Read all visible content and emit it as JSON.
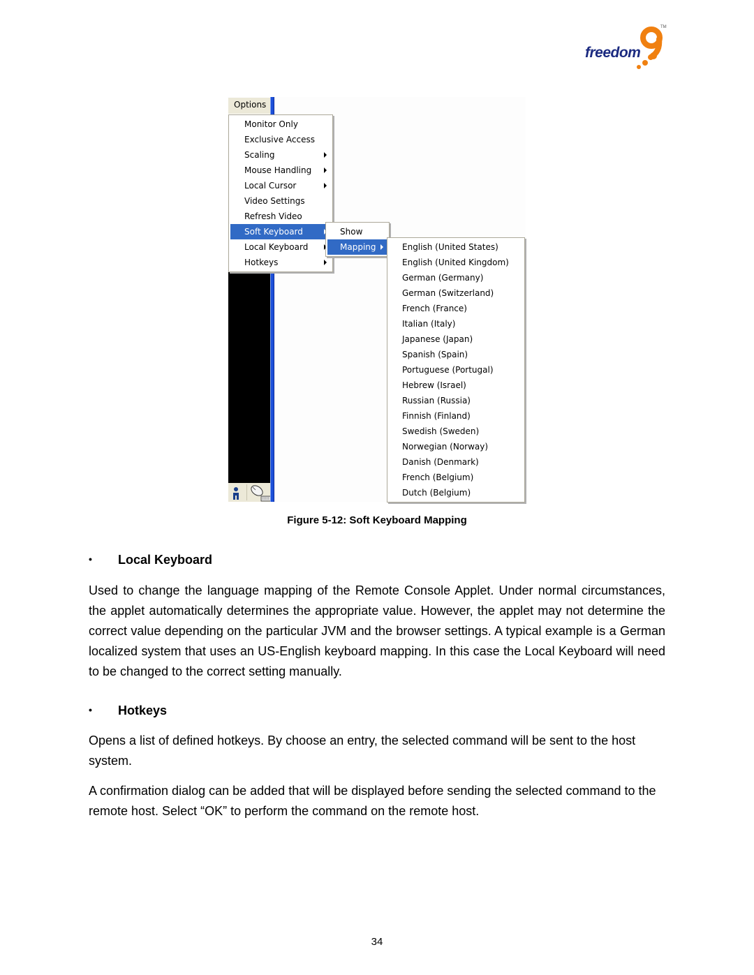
{
  "logo": {
    "text": "freedom",
    "numeral": "9",
    "trademark": "TM",
    "colors": {
      "text": "#1b2a80",
      "accent": "#f08010"
    }
  },
  "figure": {
    "menubar_label": "Options",
    "options_menu": [
      {
        "label": "Monitor Only",
        "submenu": false,
        "selected": false
      },
      {
        "label": "Exclusive Access",
        "submenu": false,
        "selected": false
      },
      {
        "label": "Scaling",
        "submenu": true,
        "selected": false
      },
      {
        "label": "Mouse Handling",
        "submenu": true,
        "selected": false
      },
      {
        "label": "Local Cursor",
        "submenu": true,
        "selected": false
      },
      {
        "label": "Video Settings",
        "submenu": false,
        "selected": false
      },
      {
        "label": "Refresh Video",
        "submenu": false,
        "selected": false
      },
      {
        "label": "Soft Keyboard",
        "submenu": true,
        "selected": true
      },
      {
        "label": "Local Keyboard",
        "submenu": true,
        "selected": false
      },
      {
        "label": "Hotkeys",
        "submenu": true,
        "selected": false
      }
    ],
    "soft_keyboard_menu": [
      {
        "label": "Show",
        "submenu": false,
        "selected": false
      },
      {
        "label": "Mapping",
        "submenu": true,
        "selected": true
      }
    ],
    "mapping_menu": [
      "English (United States)",
      "English (United Kingdom)",
      "German (Germany)",
      "German (Switzerland)",
      "French (France)",
      "Italian (Italy)",
      "Japanese (Japan)",
      "Spanish (Spain)",
      "Portuguese (Portugal)",
      "Hebrew (Israel)",
      "Russian (Russia)",
      "Finnish (Finland)",
      "Swedish (Sweden)",
      "Norwegian (Norway)",
      "Danish (Denmark)",
      "French (Belgium)",
      "Dutch (Belgium)"
    ],
    "selection_color": "#316ac5",
    "caption": "Figure 5-12: Soft Keyboard Mapping"
  },
  "sections": [
    {
      "bullet": "•",
      "heading": "Local Keyboard",
      "paragraphs": [
        "Used to change the language mapping of the Remote Console Applet. Under normal circumstances, the applet automatically determines the appropriate value. However, the applet may not determine the correct value depending on the particular JVM and the browser settings. A typical example is a German localized system that uses an US-English keyboard mapping. In this case the Local Keyboard will need to be changed to the correct setting manually."
      ]
    },
    {
      "bullet": "•",
      "heading": "Hotkeys",
      "paragraphs": [
        "Opens a list of defined hotkeys. By choose an entry, the selected command will be sent to the host system.",
        "A confirmation dialog can be added that will be displayed before sending the selected command to the remote host. Select “OK” to perform the command on the remote host."
      ]
    }
  ],
  "page_number": "34"
}
